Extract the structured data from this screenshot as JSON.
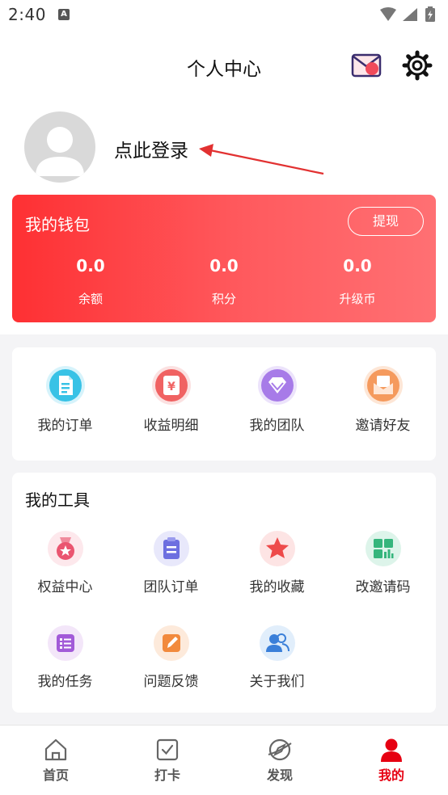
{
  "status_bar": {
    "time": "2:40",
    "sim_badge": "A",
    "icons": [
      "wifi-icon",
      "signal-icon",
      "battery-icon"
    ]
  },
  "header": {
    "title": "个人中心",
    "mail_icon": "mail-icon",
    "settings_icon": "gear-icon"
  },
  "profile": {
    "login_label": "点此登录"
  },
  "wallet": {
    "title": "我的钱包",
    "withdraw_label": "提现",
    "stats": [
      {
        "value": "0.0",
        "label": "余额"
      },
      {
        "value": "0.0",
        "label": "积分"
      },
      {
        "value": "0.0",
        "label": "升级币"
      }
    ]
  },
  "shortcuts": [
    {
      "label": "我的订单",
      "icon": "document-icon"
    },
    {
      "label": "收益明细",
      "icon": "yuan-icon"
    },
    {
      "label": "我的团队",
      "icon": "diamond-icon"
    },
    {
      "label": "邀请好友",
      "icon": "envelope-icon"
    }
  ],
  "tools": {
    "title": "我的工具",
    "items": [
      {
        "label": "权益中心",
        "icon": "medal-icon"
      },
      {
        "label": "团队订单",
        "icon": "clipboard-icon"
      },
      {
        "label": "我的收藏",
        "icon": "star-icon"
      },
      {
        "label": "改邀请码",
        "icon": "qrcode-icon"
      },
      {
        "label": "我的任务",
        "icon": "checklist-icon"
      },
      {
        "label": "问题反馈",
        "icon": "edit-icon"
      },
      {
        "label": "关于我们",
        "icon": "people-icon"
      }
    ]
  },
  "tabs": [
    {
      "label": "首页",
      "icon": "home-icon",
      "active": false
    },
    {
      "label": "打卡",
      "icon": "checkbox-icon",
      "active": false
    },
    {
      "label": "发现",
      "icon": "compass-icon",
      "active": false
    },
    {
      "label": "我的",
      "icon": "person-icon",
      "active": true
    }
  ],
  "colors": {
    "accent": "#e60012",
    "wallet_gradient_start": "#fe3033",
    "wallet_gradient_end": "#ff7073",
    "page_bg": "#f4f4f6"
  }
}
